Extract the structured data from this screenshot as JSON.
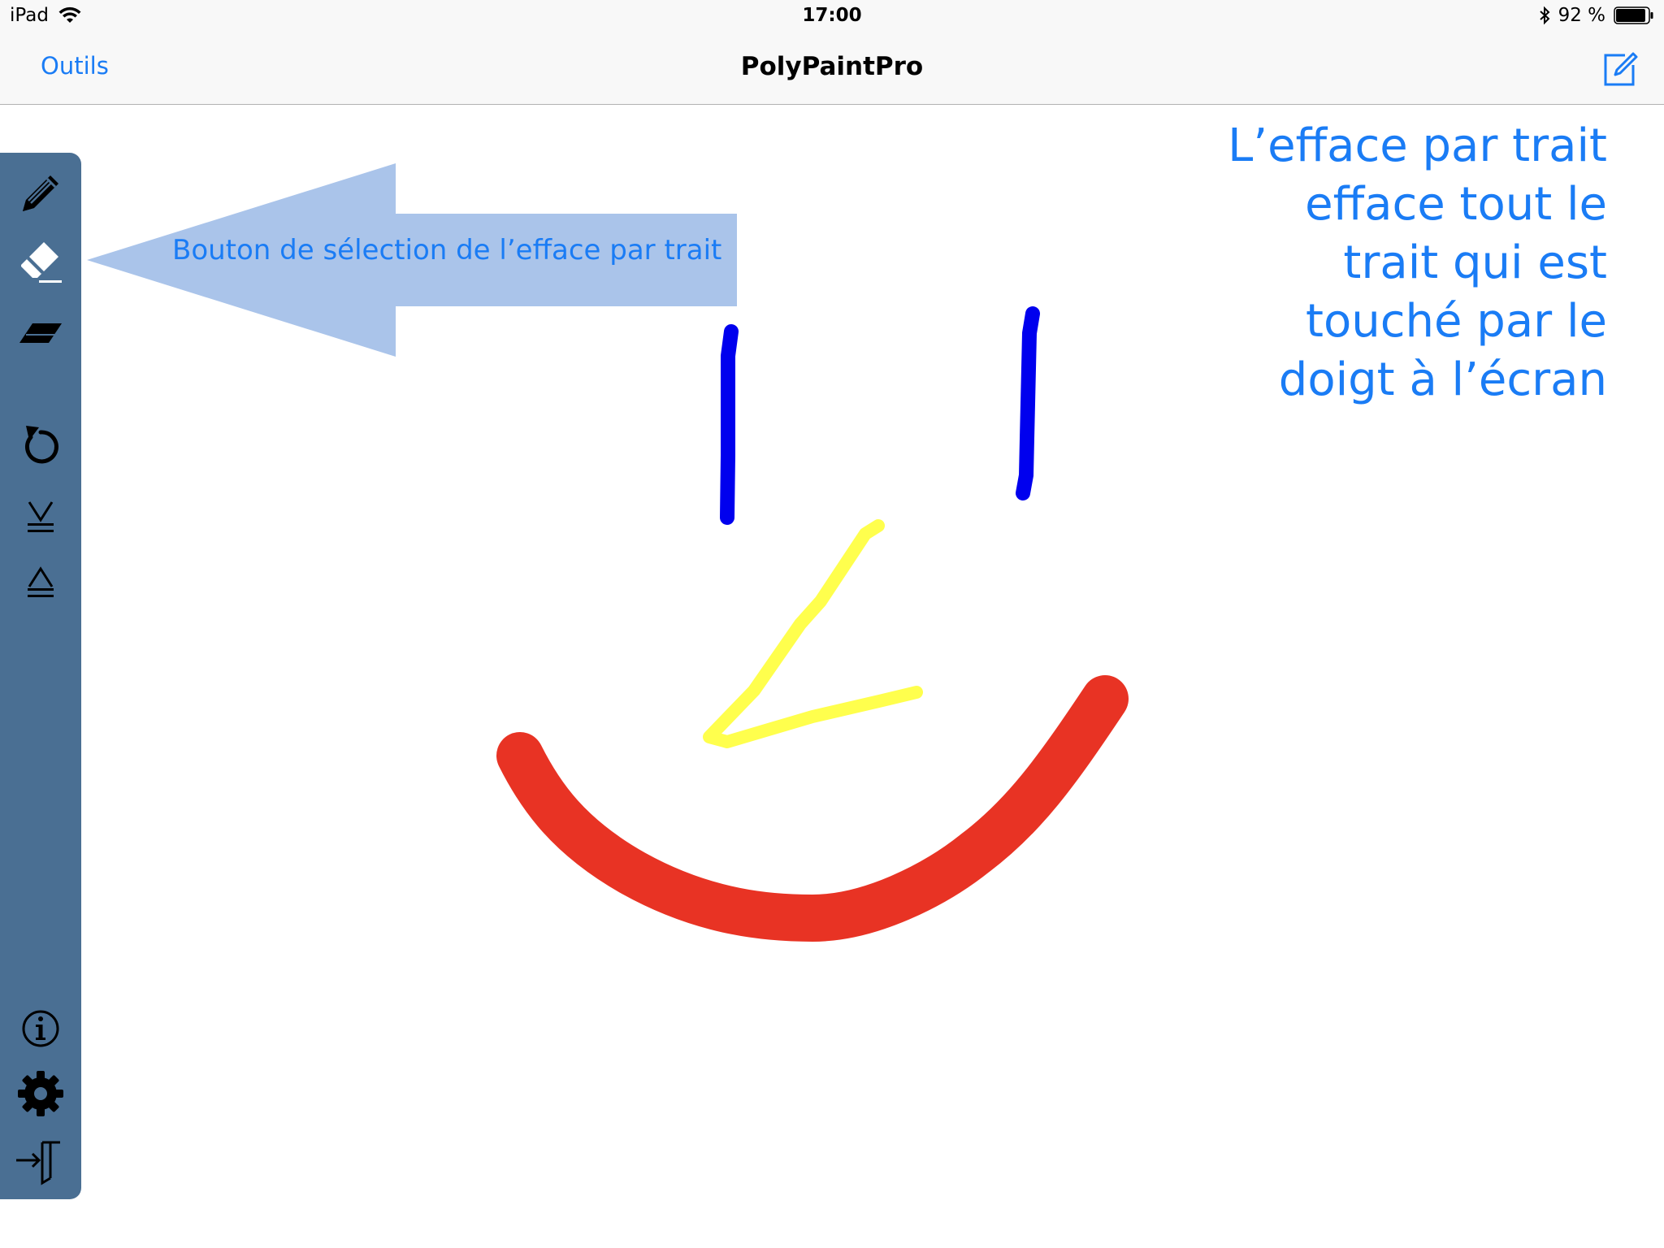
{
  "status_bar": {
    "device": "iPad",
    "time": "17:00",
    "battery_percent": "92 %",
    "battery_level": 0.92
  },
  "nav_bar": {
    "left_button": "Outils",
    "title": "PolyPaintPro"
  },
  "toolbar": {
    "background": "#4a6f93",
    "items": [
      {
        "icon": "pencil-icon"
      },
      {
        "icon": "stroke-eraser-icon"
      },
      {
        "icon": "point-eraser-icon"
      },
      {
        "icon": "undo-icon"
      },
      {
        "icon": "send-backward-icon"
      },
      {
        "icon": "bring-forward-icon"
      },
      {
        "icon": "info-icon"
      },
      {
        "icon": "gear-icon"
      },
      {
        "icon": "exit-icon"
      }
    ]
  },
  "annotation": {
    "arrow_label": "Bouton de sélection de l’efface par trait",
    "arrow_color": "#aac4ea",
    "note_lines": [
      "L’efface par trait",
      "efface tout le",
      "trait qui est",
      "touché par le",
      "doigt à l’écran"
    ]
  },
  "drawing": {
    "colors": {
      "left_eye": "#0000ee",
      "right_eye": "#0000ee",
      "nose": "#ffff4d",
      "mouth": "#e83324"
    }
  },
  "accent_color": "#1a7cf5"
}
